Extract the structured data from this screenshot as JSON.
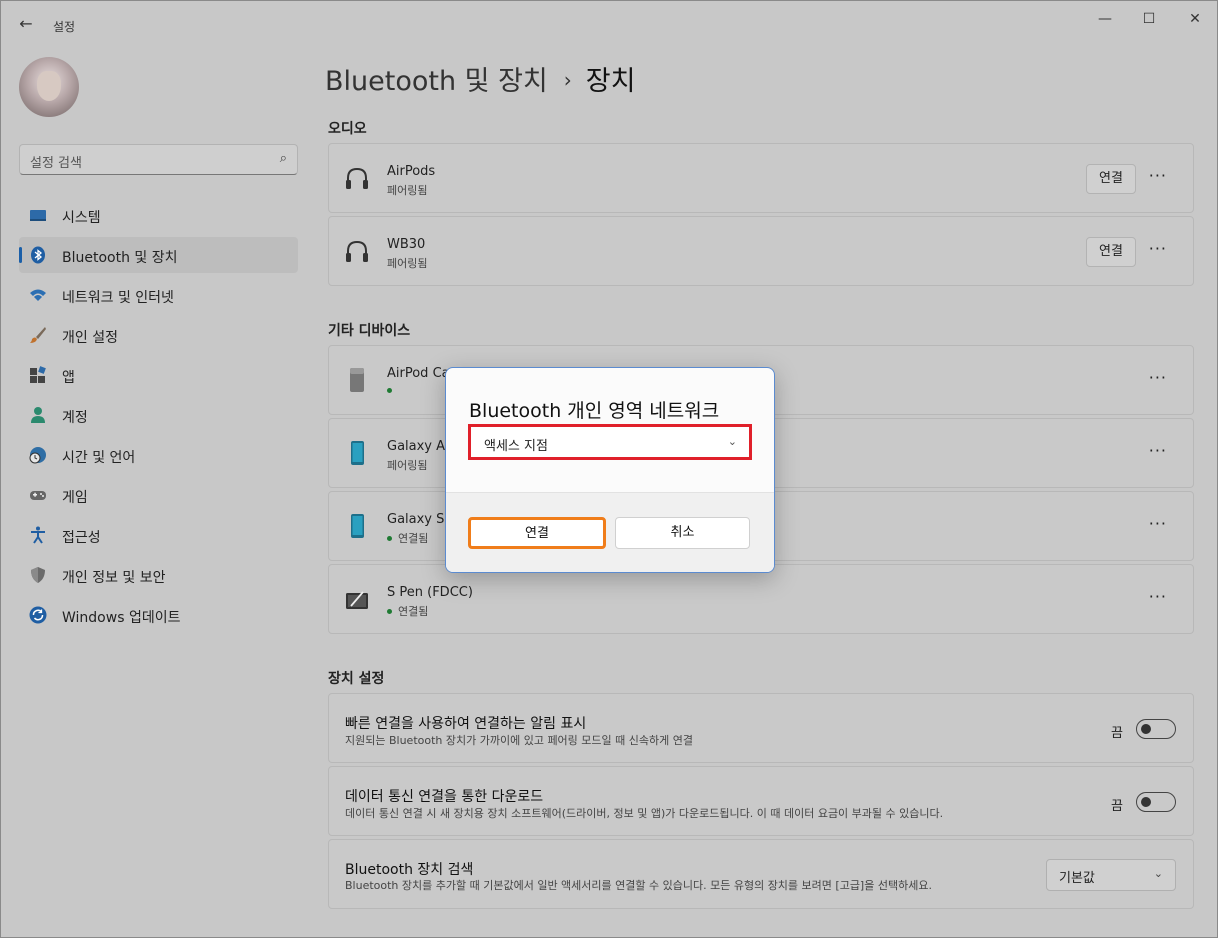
{
  "window": {
    "back_icon": "←",
    "title": "설정",
    "minimize_icon": "—",
    "maximize_icon": "☐",
    "close_icon": "✕"
  },
  "sidebar": {
    "search_placeholder": "설정 검색",
    "search_icon": "⌕",
    "items": [
      {
        "label": "시스템",
        "icon": "monitor-icon",
        "active": false
      },
      {
        "label": "Bluetooth 및 장치",
        "icon": "bluetooth-icon",
        "active": true
      },
      {
        "label": "네트워크 및 인터넷",
        "icon": "wifi-icon",
        "active": false
      },
      {
        "label": "개인 설정",
        "icon": "brush-icon",
        "active": false
      },
      {
        "label": "앱",
        "icon": "apps-icon",
        "active": false
      },
      {
        "label": "계정",
        "icon": "person-icon",
        "active": false
      },
      {
        "label": "시간 및 언어",
        "icon": "globe-clock-icon",
        "active": false
      },
      {
        "label": "게임",
        "icon": "gamepad-icon",
        "active": false
      },
      {
        "label": "접근성",
        "icon": "accessibility-icon",
        "active": false
      },
      {
        "label": "개인 정보 및 보안",
        "icon": "shield-icon",
        "active": false
      },
      {
        "label": "Windows 업데이트",
        "icon": "update-icon",
        "active": false
      }
    ]
  },
  "breadcrumb": {
    "parent": "Bluetooth 및 장치",
    "separator": "›",
    "current": "장치"
  },
  "audio": {
    "title": "오디오",
    "devices": [
      {
        "name": "AirPods",
        "status": "페어링됨",
        "action": "연결",
        "icon": "headphones-icon"
      },
      {
        "name": "WB30",
        "status": "페어링됨",
        "action": "연결",
        "icon": "headphones-icon"
      }
    ]
  },
  "other": {
    "title": "기타 디바이스",
    "devices": [
      {
        "name": "AirPod Ca",
        "status": "",
        "connected": true,
        "icon": "case-icon"
      },
      {
        "name": "Galaxy A8",
        "status": "페어링됨",
        "connected": false,
        "icon": "phone-icon"
      },
      {
        "name": "Galaxy S5",
        "status": "연결됨",
        "connected": true,
        "icon": "phone-icon"
      },
      {
        "name": "S Pen (FDCC)",
        "status": "연결됨",
        "connected": true,
        "icon": "pen-tablet-icon"
      }
    ]
  },
  "more_label": "···",
  "device_settings": {
    "title": "장치 설정",
    "swift_pair": {
      "title": "빠른 연결을 사용하여 연결하는 알림 표시",
      "desc": "지원되는 Bluetooth 장치가 가까이에 있고 페어링 모드일 때 신속하게 연결",
      "state": "끔"
    },
    "metered": {
      "title": "데이터 통신 연결을 통한 다운로드",
      "desc": "데이터 통신 연결 시 새 장치용 장치 소프트웨어(드라이버, 정보 및 앱)가 다운로드됩니다. 이 때 데이터 요금이 부과될 수 있습니다.",
      "state": "끔"
    },
    "discovery": {
      "title": "Bluetooth 장치 검색",
      "desc": "Bluetooth 장치를 추가할 때 기본값에서 일반 액세서리를 연결할 수 있습니다. 모든 유형의 장치를 보려면 [고급]을 선택하세요.",
      "value": "기본값"
    }
  },
  "dialog": {
    "title": "Bluetooth 개인 영역 네트워크",
    "select_value": "액세스 지점",
    "ok": "연결",
    "cancel": "취소"
  },
  "colors": {
    "highlight_select": "#e0202a",
    "highlight_ok": "#f07d1a",
    "accent": "#1b5fa8"
  }
}
